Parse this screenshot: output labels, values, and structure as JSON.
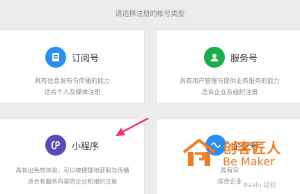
{
  "prompt": "请选择注册的帐号类型",
  "cards": [
    {
      "title": "订阅号",
      "desc1": "具有信息发布与传播的能力",
      "desc2": "适合个人及媒体注册",
      "icon": "subscription-icon",
      "color": "#2c8ff0"
    },
    {
      "title": "服务号",
      "desc1": "具有用户管理与提供业务服务的能力",
      "desc2": "适合企业及组织注册",
      "icon": "service-user-icon",
      "color": "#1aad4b"
    },
    {
      "title": "小程序",
      "desc1": "具有出色的体验，可以被便捷地获取与传播",
      "desc2": "适合有服务内容的企业和组织注册",
      "icon": "miniprogram-icon",
      "color": "#5b4bb8"
    },
    {
      "title": "企业号",
      "desc1": "具有实",
      "desc2": "适合企业",
      "icon": "enterprise-icon",
      "color": "#2c8ff0"
    }
  ],
  "annotation": {
    "color": "#f0356b"
  },
  "watermark": {
    "cn": "创客匠人",
    "en": "Be Maker",
    "site": "Baidu 经验",
    "color": "#f47a20"
  }
}
